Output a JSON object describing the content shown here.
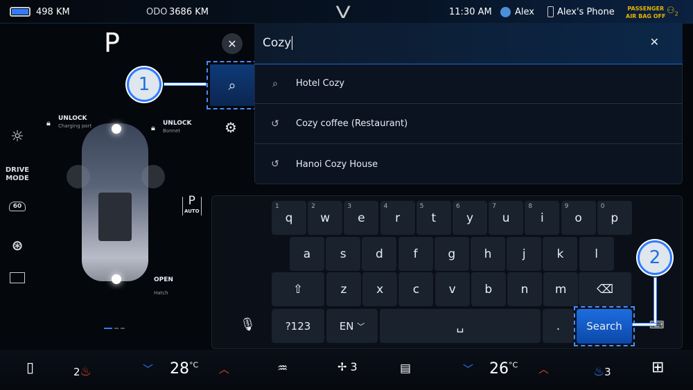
{
  "status": {
    "range": "498 KM",
    "odo_label": "ODO",
    "odo_value": "3686 KM",
    "time": "11:30 AM",
    "user": "Alex",
    "phone": "Alex's Phone",
    "airbag_line1": "PASSENGER",
    "airbag_line2": "AIR BAG OFF",
    "airbag_num": "2"
  },
  "vehicle": {
    "gear": "P",
    "charging_state": "UNLOCK",
    "charging_label": "Charging port",
    "bonnet_state": "UNLOCK",
    "bonnet_label": "Bonnet",
    "hatch_state": "OPEN",
    "hatch_label": "Hatch",
    "auto_park": "P",
    "auto_park_sub": "AUTO"
  },
  "sidebar": {
    "drive_mode_1": "DRIVE",
    "drive_mode_2": "MODE",
    "speed_limit": "60"
  },
  "search": {
    "query": "Cozy",
    "suggestions": [
      {
        "icon": "search-icon",
        "text": "Hotel Cozy"
      },
      {
        "icon": "history-icon",
        "text": "Cozy coffee (Restaurant)"
      },
      {
        "icon": "history-icon",
        "text": "Hanoi Cozy House"
      }
    ]
  },
  "callouts": {
    "one": "1",
    "two": "2"
  },
  "keyboard": {
    "row1": [
      [
        "q",
        "1"
      ],
      [
        "w",
        "2"
      ],
      [
        "e",
        "3"
      ],
      [
        "r",
        "4"
      ],
      [
        "t",
        "5"
      ],
      [
        "y",
        "6"
      ],
      [
        "u",
        "7"
      ],
      [
        "i",
        "8"
      ],
      [
        "o",
        "9"
      ],
      [
        "p",
        "0"
      ]
    ],
    "row2": [
      "a",
      "s",
      "d",
      "f",
      "g",
      "h",
      "j",
      "k",
      "l"
    ],
    "row3": [
      "z",
      "x",
      "c",
      "v",
      "b",
      "n",
      "m"
    ],
    "symbols": "?123",
    "lang": "EN",
    "period": ".",
    "search": "Search"
  },
  "climate": {
    "left_seat": "2",
    "left_temp": "28",
    "unit": "°C",
    "fan": "3",
    "right_temp": "26",
    "right_seat": "3"
  },
  "colors": {
    "accent": "#1f6fe0",
    "heat": "#e0452b",
    "airbag": "#e6b400"
  }
}
